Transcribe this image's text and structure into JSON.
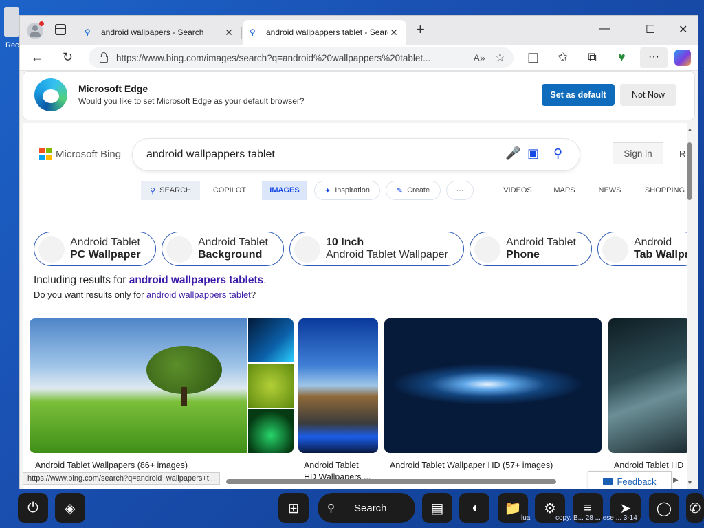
{
  "desktop": {
    "icon_label": "Rec"
  },
  "browser": {
    "tabs": [
      {
        "title": "android wallpapers - Search",
        "active": false
      },
      {
        "title": "android wallpappers tablet - Search",
        "active": true
      }
    ],
    "new_tab": "+",
    "window_controls": {
      "minimize": "—",
      "maximize": "☐",
      "close": "✕"
    },
    "address": "https://www.bing.com/images/search?q=android%20wallpappers%20tablet...",
    "read_aloud": "A»",
    "more_label": "···"
  },
  "infobar": {
    "title": "Microsoft Edge",
    "message": "Would you like to set Microsoft Edge as your default browser?",
    "primary_button": "Set as default",
    "secondary_button": "Not Now"
  },
  "bing": {
    "logo_text": "Microsoft Bing",
    "logo_colors": [
      "#f25022",
      "#7fba00",
      "#00a4ef",
      "#ffb900"
    ],
    "query": "android wallpappers tablet",
    "sign_in": "Sign in",
    "rewards_initial": "R",
    "nav": {
      "search": "SEARCH",
      "copilot": "COPILOT",
      "images": "IMAGES",
      "inspiration": "Inspiration",
      "create": "Create",
      "more": "···",
      "videos": "VIDEOS",
      "maps": "MAPS",
      "news": "NEWS",
      "shopping": "SHOPPING"
    },
    "related": [
      {
        "line1": "Android Tablet",
        "line2": "PC Wallpaper",
        "bold_line": 2
      },
      {
        "line1": "Android Tablet",
        "line2": "Background",
        "bold_line": 2
      },
      {
        "line1": "10 Inch",
        "line2": "Android Tablet Wallpaper",
        "bold_line": 1
      },
      {
        "line1": "Android Tablet",
        "line2": "Phone",
        "bold_line": 2
      },
      {
        "line1": "Android",
        "line2": "Tab Wallpa",
        "bold_line": 2
      }
    ],
    "including_prefix": "Including results for",
    "including_link": "android wallpapers tablets",
    "including_suffix": ".",
    "only_prefix": "Do you want results only for",
    "only_link": "android wallpappers tablet",
    "only_suffix": "?",
    "results": [
      {
        "caption": "Android Tablet Wallpapers (86+ images)"
      },
      {
        "caption_line1": "Android Tablet",
        "caption_line2": "HD Wallpapers ..."
      },
      {
        "caption": "Android Tablet Wallpaper HD (57+ images)"
      },
      {
        "caption": "Android Tablet HD"
      }
    ],
    "feedback": "Feedback",
    "status_url": "https://www.bing.com/search?q=android+wallpapers+t..."
  },
  "taskbar": {
    "search_label": "Search",
    "tray_text_left": "lua",
    "tray_text_right": "copy. B... 28 ... ese ... 3-14"
  }
}
